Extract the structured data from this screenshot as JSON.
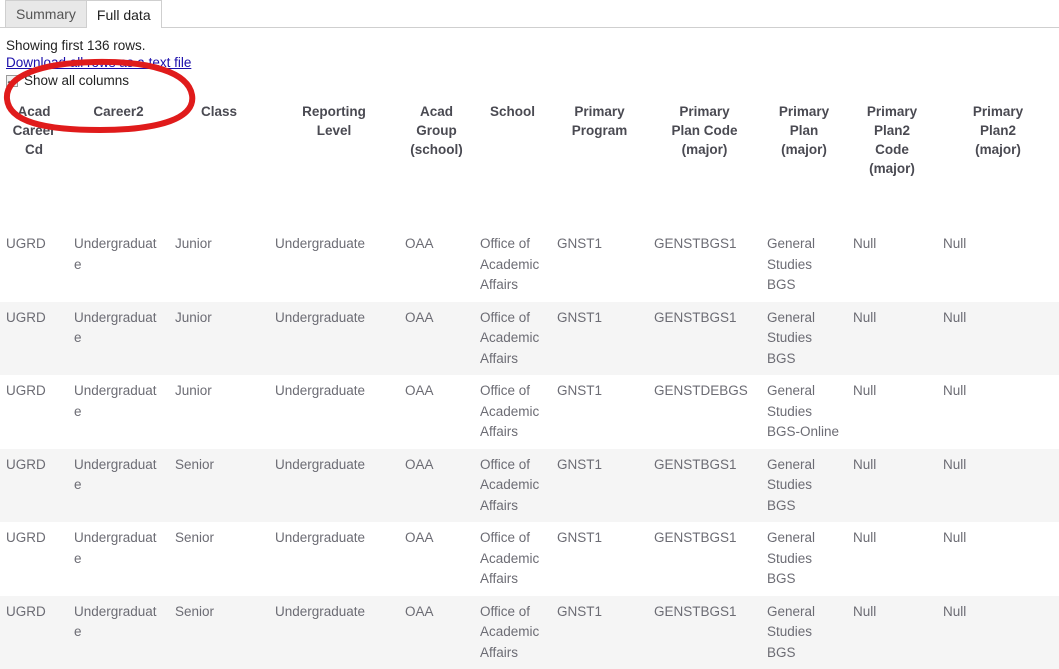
{
  "tabs": [
    {
      "label": "Summary",
      "active": false
    },
    {
      "label": "Full data",
      "active": true
    }
  ],
  "meta": {
    "showing_text": "Showing first 136 rows.",
    "download_link": "Download all rows as a text file",
    "show_all_columns_label": "Show all columns",
    "show_all_columns_checked": true
  },
  "annotation": {
    "shape": "ellipse",
    "color": "#e01b1b",
    "stroke_width": 5
  },
  "table": {
    "columns": [
      "Acad Career Cd",
      "Career2",
      "Class",
      "Reporting Level",
      "Acad Group (school)",
      "School",
      "Primary Program",
      "Primary Plan Code (major)",
      "Primary Plan (major)",
      "Primary Plan2 Code (major)",
      "Primary Plan2 (major)"
    ],
    "column_lines": [
      [
        "Acad",
        "Career",
        "Cd"
      ],
      [
        "Career2"
      ],
      [
        "Class"
      ],
      [
        "Reporting",
        "Level"
      ],
      [
        "Acad",
        "Group",
        "(school)"
      ],
      [
        "School"
      ],
      [
        "Primary",
        "Program"
      ],
      [
        "Primary",
        "Plan Code",
        "(major)"
      ],
      [
        "Primary",
        "Plan",
        "(major)"
      ],
      [
        "Primary",
        "Plan2",
        "Code",
        "(major)"
      ],
      [
        "Primary",
        "Plan2",
        "(major)"
      ]
    ],
    "rows": [
      {
        "stripe": false,
        "cells": [
          "UGRD",
          "Undergraduate",
          "Junior",
          "Undergraduate",
          "OAA",
          "Office of Academic Affairs",
          "GNST1",
          "GENSTBGS1",
          "General Studies BGS",
          "Null",
          "Null"
        ]
      },
      {
        "stripe": true,
        "cells": [
          "UGRD",
          "Undergraduate",
          "Junior",
          "Undergraduate",
          "OAA",
          "Office of Academic Affairs",
          "GNST1",
          "GENSTBGS1",
          "General Studies BGS",
          "Null",
          "Null"
        ]
      },
      {
        "stripe": false,
        "cells": [
          "UGRD",
          "Undergraduate",
          "Junior",
          "Undergraduate",
          "OAA",
          "Office of Academic Affairs",
          "GNST1",
          "GENSTDEBGS",
          "General Studies BGS-Online",
          "Null",
          "Null"
        ]
      },
      {
        "stripe": true,
        "cells": [
          "UGRD",
          "Undergraduate",
          "Senior",
          "Undergraduate",
          "OAA",
          "Office of Academic Affairs",
          "GNST1",
          "GENSTBGS1",
          "General Studies BGS",
          "Null",
          "Null"
        ]
      },
      {
        "stripe": false,
        "cells": [
          "UGRD",
          "Undergraduate",
          "Senior",
          "Undergraduate",
          "OAA",
          "Office of Academic Affairs",
          "GNST1",
          "GENSTBGS1",
          "General Studies BGS",
          "Null",
          "Null"
        ]
      },
      {
        "stripe": true,
        "cells": [
          "UGRD",
          "Undergraduate",
          "Senior",
          "Undergraduate",
          "OAA",
          "Office of Academic Affairs",
          "GNST1",
          "GENSTBGS1",
          "General Studies BGS",
          "Null",
          "Null"
        ]
      }
    ]
  }
}
